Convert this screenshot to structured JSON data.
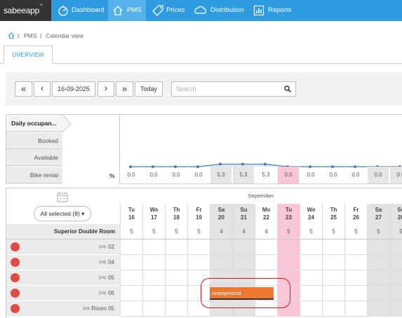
{
  "app": {
    "logo": "sabeeapp",
    "logo_tm": "™"
  },
  "nav": [
    {
      "label": "Dashboard",
      "icon": "speedometer-icon"
    },
    {
      "label": "PMS",
      "icon": "house-icon",
      "active": true
    },
    {
      "label": "Prices",
      "icon": "tag-icon"
    },
    {
      "label": "Distribution",
      "icon": "cloud-icon"
    },
    {
      "label": "Reports",
      "icon": "bar-chart-icon"
    }
  ],
  "breadcrumb": {
    "home_icon": "home-icon",
    "sep": "/",
    "items": [
      "PMS",
      "Calendar view"
    ]
  },
  "tabs": [
    {
      "label": "OVERVIEW",
      "active": true
    }
  ],
  "toolbar": {
    "first": "«",
    "prev": "‹",
    "date": "16-09-2025",
    "next": "›",
    "last": "»",
    "today": "Today",
    "search_placeholder": "Search",
    "search_icon": "magnifier-icon"
  },
  "occupancy": {
    "labels": [
      "Daily occupan...",
      "Booked",
      "Available",
      "Bike rental"
    ],
    "unit": "%",
    "values": [
      "0.0",
      "0.0",
      "0.0",
      "0.0",
      "5.3",
      "5.3",
      "5.3",
      "0.0",
      "0.0",
      "0.0",
      "0.0",
      "0.0",
      "0.0"
    ],
    "numeric": [
      0,
      0,
      0,
      0,
      5.3,
      5.3,
      5.3,
      0,
      0,
      0,
      0,
      0,
      0
    ]
  },
  "calendar": {
    "calendar_icon": "calendar-icon",
    "filter": "All selected (8) ▾",
    "month": "September",
    "days": [
      {
        "dow": "Tu",
        "d": "16",
        "type": ""
      },
      {
        "dow": "We",
        "d": "17",
        "type": ""
      },
      {
        "dow": "Th",
        "d": "18",
        "type": ""
      },
      {
        "dow": "Fr",
        "d": "19",
        "type": ""
      },
      {
        "dow": "Sa",
        "d": "20",
        "type": "wknd"
      },
      {
        "dow": "Su",
        "d": "21",
        "type": "wknd"
      },
      {
        "dow": "Mo",
        "d": "22",
        "type": ""
      },
      {
        "dow": "Tu",
        "d": "23",
        "type": "today"
      },
      {
        "dow": "We",
        "d": "24",
        "type": ""
      },
      {
        "dow": "Th",
        "d": "25",
        "type": ""
      },
      {
        "dow": "Fr",
        "d": "26",
        "type": ""
      },
      {
        "dow": "Sa",
        "d": "27",
        "type": "wknd"
      },
      {
        "dow": "Su",
        "d": "28",
        "type": "wknd"
      }
    ],
    "room_type": "Superior Double Room",
    "availability": [
      "5",
      "5",
      "5",
      "5",
      "4",
      "4",
      "4",
      "5",
      "5",
      "5",
      "5",
      "5",
      "5"
    ],
    "rooms": [
      "02",
      "04",
      "05",
      "06",
      "Room 05"
    ],
    "booking": {
      "label": "Anonymized",
      "color": "#f0772f"
    }
  }
}
